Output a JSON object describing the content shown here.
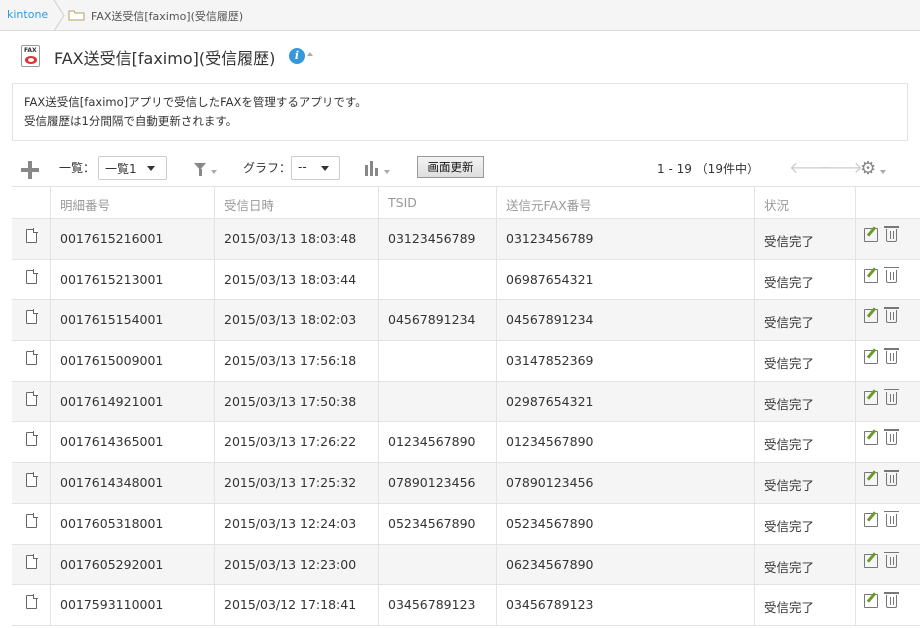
{
  "breadcrumb": {
    "home": "kintone",
    "app": "FAX送受信[faximo](受信履歴)"
  },
  "header": {
    "title": "FAX送受信[faximo](受信履歴)",
    "icon_text": "FAX"
  },
  "description": {
    "line1": "FAX送受信[faximo]アプリで受信したFAXを管理するアプリです。",
    "line2": "受信履歴は1分間隔で自動更新されます。"
  },
  "toolbar": {
    "view_label": "一覧：",
    "view_value": "一覧1",
    "graph_label": "グラフ：",
    "graph_value": "--",
    "refresh_label": "画面更新",
    "pager": "1 - 19 （19件中）"
  },
  "table": {
    "columns": [
      "明細番号",
      "受信日時",
      "TSID",
      "送信元FAX番号",
      "状況"
    ],
    "rows": [
      {
        "id": "0017615216001",
        "datetime": "2015/03/13 18:03:48",
        "tsid": "03123456789",
        "from": "03123456789",
        "status": "受信完了"
      },
      {
        "id": "0017615213001",
        "datetime": "2015/03/13 18:03:44",
        "tsid": "",
        "from": "06987654321",
        "status": "受信完了"
      },
      {
        "id": "0017615154001",
        "datetime": "2015/03/13 18:02:03",
        "tsid": "04567891234",
        "from": "04567891234",
        "status": "受信完了"
      },
      {
        "id": "0017615009001",
        "datetime": "2015/03/13 17:56:18",
        "tsid": "",
        "from": "03147852369",
        "status": "受信完了"
      },
      {
        "id": "0017614921001",
        "datetime": "2015/03/13 17:50:38",
        "tsid": "",
        "from": "02987654321",
        "status": "受信完了"
      },
      {
        "id": "0017614365001",
        "datetime": "2015/03/13 17:26:22",
        "tsid": "01234567890",
        "from": "01234567890",
        "status": "受信完了"
      },
      {
        "id": "0017614348001",
        "datetime": "2015/03/13 17:25:32",
        "tsid": "07890123456",
        "from": "07890123456",
        "status": "受信完了"
      },
      {
        "id": "0017605318001",
        "datetime": "2015/03/13 12:24:03",
        "tsid": "05234567890",
        "from": "05234567890",
        "status": "受信完了"
      },
      {
        "id": "0017605292001",
        "datetime": "2015/03/13 12:23:00",
        "tsid": "",
        "from": "06234567890",
        "status": "受信完了"
      },
      {
        "id": "0017593110001",
        "datetime": "2015/03/12 17:18:41",
        "tsid": "03456789123",
        "from": "03456789123",
        "status": "受信完了"
      }
    ]
  }
}
